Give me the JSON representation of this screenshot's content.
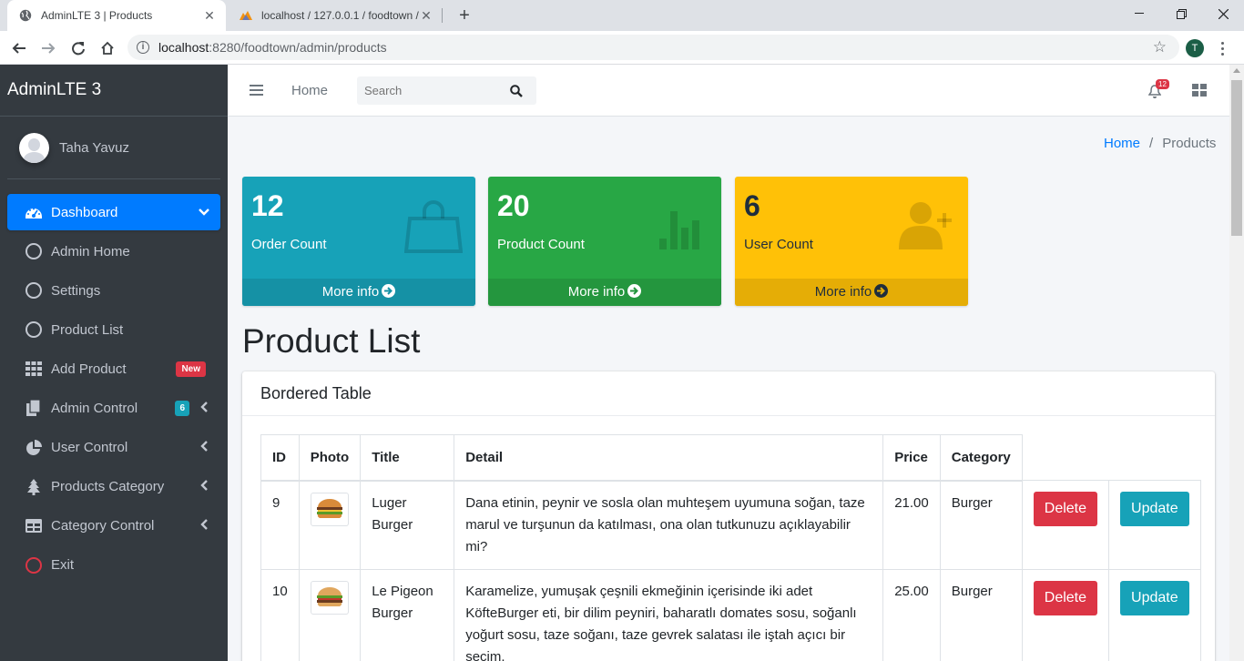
{
  "browser": {
    "tabs": [
      {
        "title": "AdminLTE 3 | Products",
        "active": true
      },
      {
        "title": "localhost / 127.0.0.1 / foodtown / ",
        "active": false
      }
    ],
    "url_host": "localhost",
    "url_path": ":8280/foodtown/admin/products",
    "profile_initial": "T"
  },
  "sidebar": {
    "brand": "AdminLTE 3",
    "user_name": "Taha Yavuz",
    "items": [
      {
        "label": "Dashboard",
        "icon": "tachometer-icon",
        "active": true
      },
      {
        "label": "Admin Home",
        "icon": "circle-icon"
      },
      {
        "label": "Settings",
        "icon": "circle-icon"
      },
      {
        "label": "Product List",
        "icon": "circle-icon"
      },
      {
        "label": "Add Product",
        "icon": "th-icon",
        "badge": "New"
      },
      {
        "label": "Admin Control",
        "icon": "copy-icon",
        "badge": "6"
      },
      {
        "label": "User Control",
        "icon": "chart-pie-icon"
      },
      {
        "label": "Products Category",
        "icon": "tree-icon"
      },
      {
        "label": "Category Control",
        "icon": "table-icon"
      },
      {
        "label": "Exit",
        "icon": "circle-red-icon"
      }
    ]
  },
  "navbar": {
    "home": "Home",
    "search_placeholder": "Search",
    "notification_count": "12"
  },
  "breadcrumb": {
    "home": "Home",
    "current": "Products"
  },
  "stats": [
    {
      "value": "12",
      "label": "Order Count",
      "more": "More info",
      "color": "#17a2b8",
      "footer_color": "#1591a5",
      "text_color": "#ffffff",
      "icon": "shopping-bag-icon"
    },
    {
      "value": "20",
      "label": "Product Count",
      "more": "More info",
      "color": "#28a745",
      "footer_color": "#24963e",
      "text_color": "#ffffff",
      "icon": "bar-chart-icon"
    },
    {
      "value": "6",
      "label": "User Count",
      "more": "More info",
      "color": "#ffc107",
      "footer_color": "#e5ad06",
      "text_color": "#1f2d3d",
      "icon": "user-plus-icon"
    }
  ],
  "page_title": "Product List",
  "card_title": "Bordered Table",
  "table": {
    "headers": [
      "ID",
      "Photo",
      "Title",
      "Detail",
      "Price",
      "Category"
    ],
    "rows": [
      {
        "id": "9",
        "title": "Luger Burger",
        "detail": "Dana etinin, peynir ve sosla olan muhteşem uyumuna soğan, taze marul ve turşunun da katılması, ona olan tutkunuzu açıklayabilir mi?",
        "price": "21.00",
        "category": "Burger",
        "delete": "Delete",
        "update": "Update"
      },
      {
        "id": "10",
        "title": "Le Pigeon Burger",
        "detail": "Karamelize, yumuşak çeşnili ekmeğinin içerisinde iki adet KöfteBurger eti, bir dilim peyniri, baharatlı domates sosu, soğanlı yoğurt sosu, taze soğanı, taze gevrek salatası ile iştah açıcı bir seçim.",
        "price": "25.00",
        "category": "Burger",
        "delete": "Delete",
        "update": "Update"
      }
    ]
  }
}
